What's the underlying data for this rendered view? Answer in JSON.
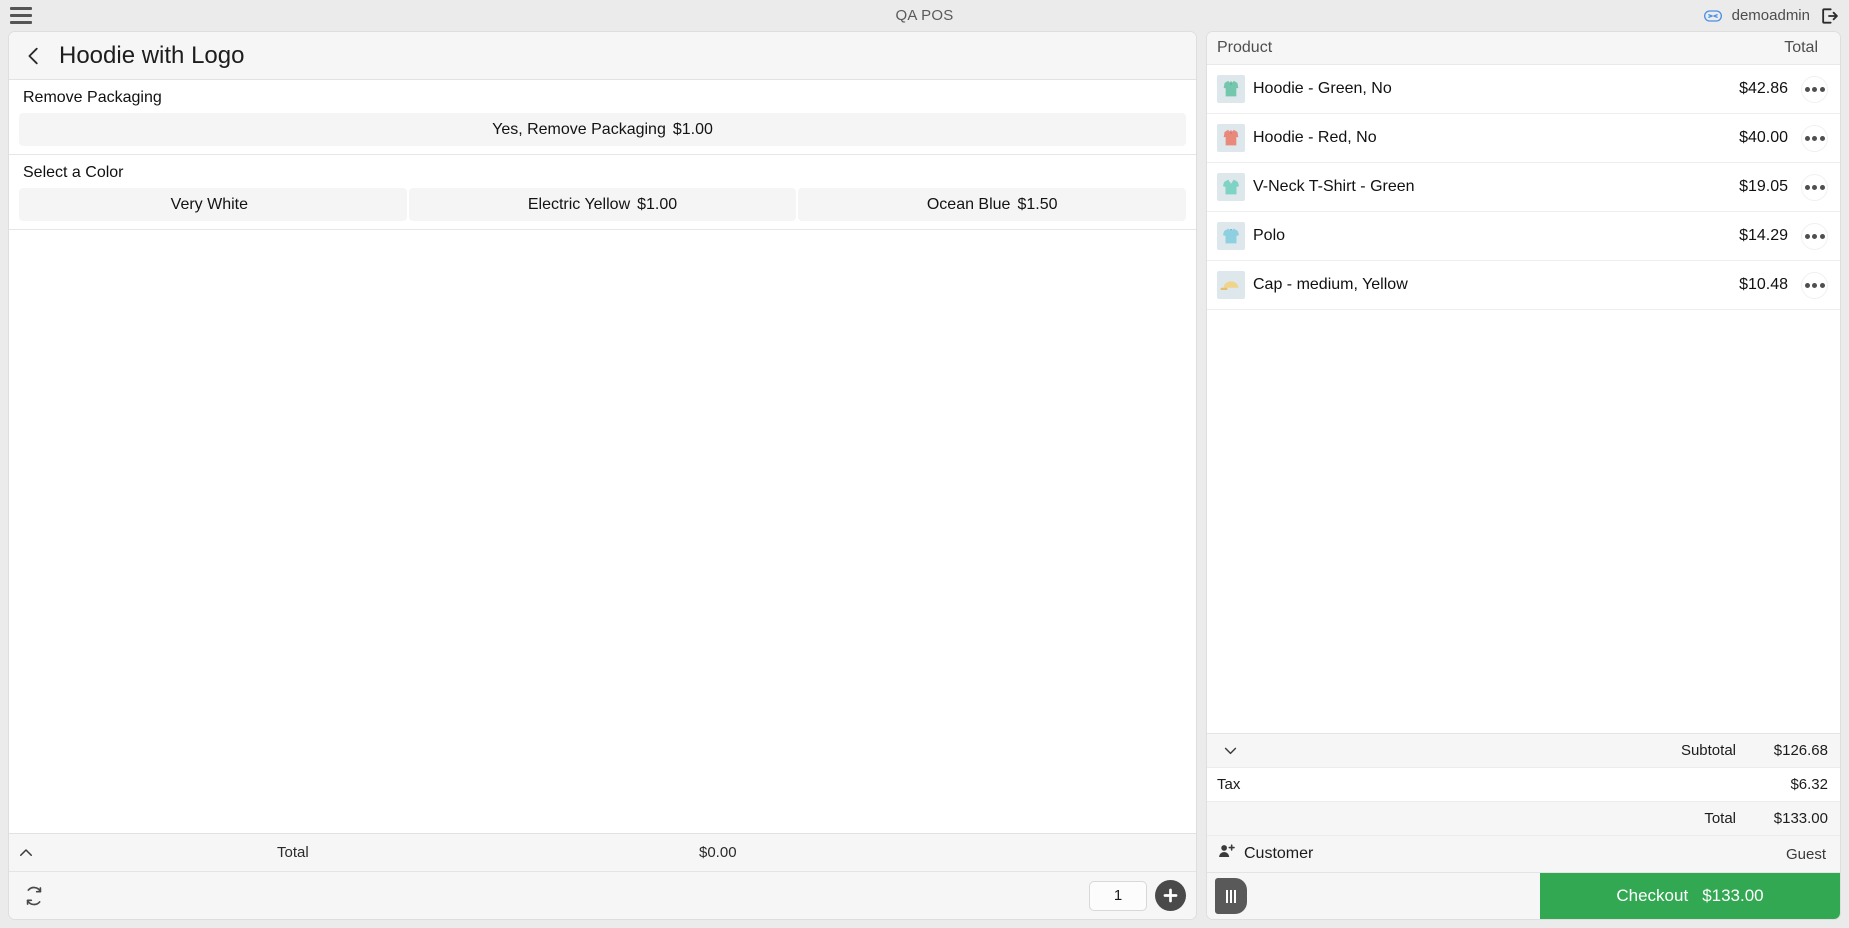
{
  "topbar": {
    "menu_icon": "hamburger-icon",
    "title": "QA POS",
    "user_icon": "user-badge-icon",
    "username": "demoadmin",
    "logout_icon": "logout-icon"
  },
  "product_panel": {
    "back_icon": "chevron-left-icon",
    "title": "Hoodie with Logo",
    "attributes": [
      {
        "label": "Remove Packaging",
        "options": [
          {
            "name": "Yes, Remove Packaging",
            "price": "$1.00"
          }
        ]
      },
      {
        "label": "Select a Color",
        "options": [
          {
            "name": "Very White",
            "price": ""
          },
          {
            "name": "Electric Yellow",
            "price": "$1.00"
          },
          {
            "name": "Ocean Blue",
            "price": "$1.50"
          }
        ]
      }
    ],
    "footer": {
      "collapse_icon": "chevron-up-icon",
      "total_label": "Total",
      "total_value": "$0.00",
      "refresh_icon": "refresh-icon",
      "quantity": "1",
      "add_icon": "plus-circle-icon"
    }
  },
  "cart_panel": {
    "columns": {
      "product": "Product",
      "total": "Total"
    },
    "items": [
      {
        "thumb": "hoodie-green-icon",
        "name": "Hoodie - Green, No",
        "total": "$42.86",
        "menu_icon": "ellipsis-icon",
        "color": "#74c7ad"
      },
      {
        "thumb": "hoodie-red-icon",
        "name": "Hoodie - Red, No",
        "total": "$40.00",
        "menu_icon": "ellipsis-icon",
        "color": "#e8897b"
      },
      {
        "thumb": "vneck-green-icon",
        "name": "V-Neck T-Shirt - Green",
        "total": "$19.05",
        "menu_icon": "ellipsis-icon",
        "color": "#7fd3c4"
      },
      {
        "thumb": "polo-blue-icon",
        "name": "Polo",
        "total": "$14.29",
        "menu_icon": "ellipsis-icon",
        "color": "#8fd0e0"
      },
      {
        "thumb": "cap-yellow-icon",
        "name": "Cap - medium, Yellow",
        "total": "$10.48",
        "menu_icon": "ellipsis-icon",
        "color": "#f0d48a"
      }
    ],
    "totals": {
      "expand_icon": "chevron-down-icon",
      "subtotal_label": "Subtotal",
      "subtotal_value": "$126.68",
      "tax_label": "Tax",
      "tax_value": "$6.32",
      "total_label": "Total",
      "total_value": "$133.00"
    },
    "customer": {
      "icon": "add-customer-icon",
      "label": "Customer",
      "value": "Guest"
    },
    "actions": {
      "hold_icon": "hold-order-icon",
      "checkout_label": "Checkout",
      "checkout_amount": "$133.00",
      "checkout_color": "#32a852"
    }
  }
}
